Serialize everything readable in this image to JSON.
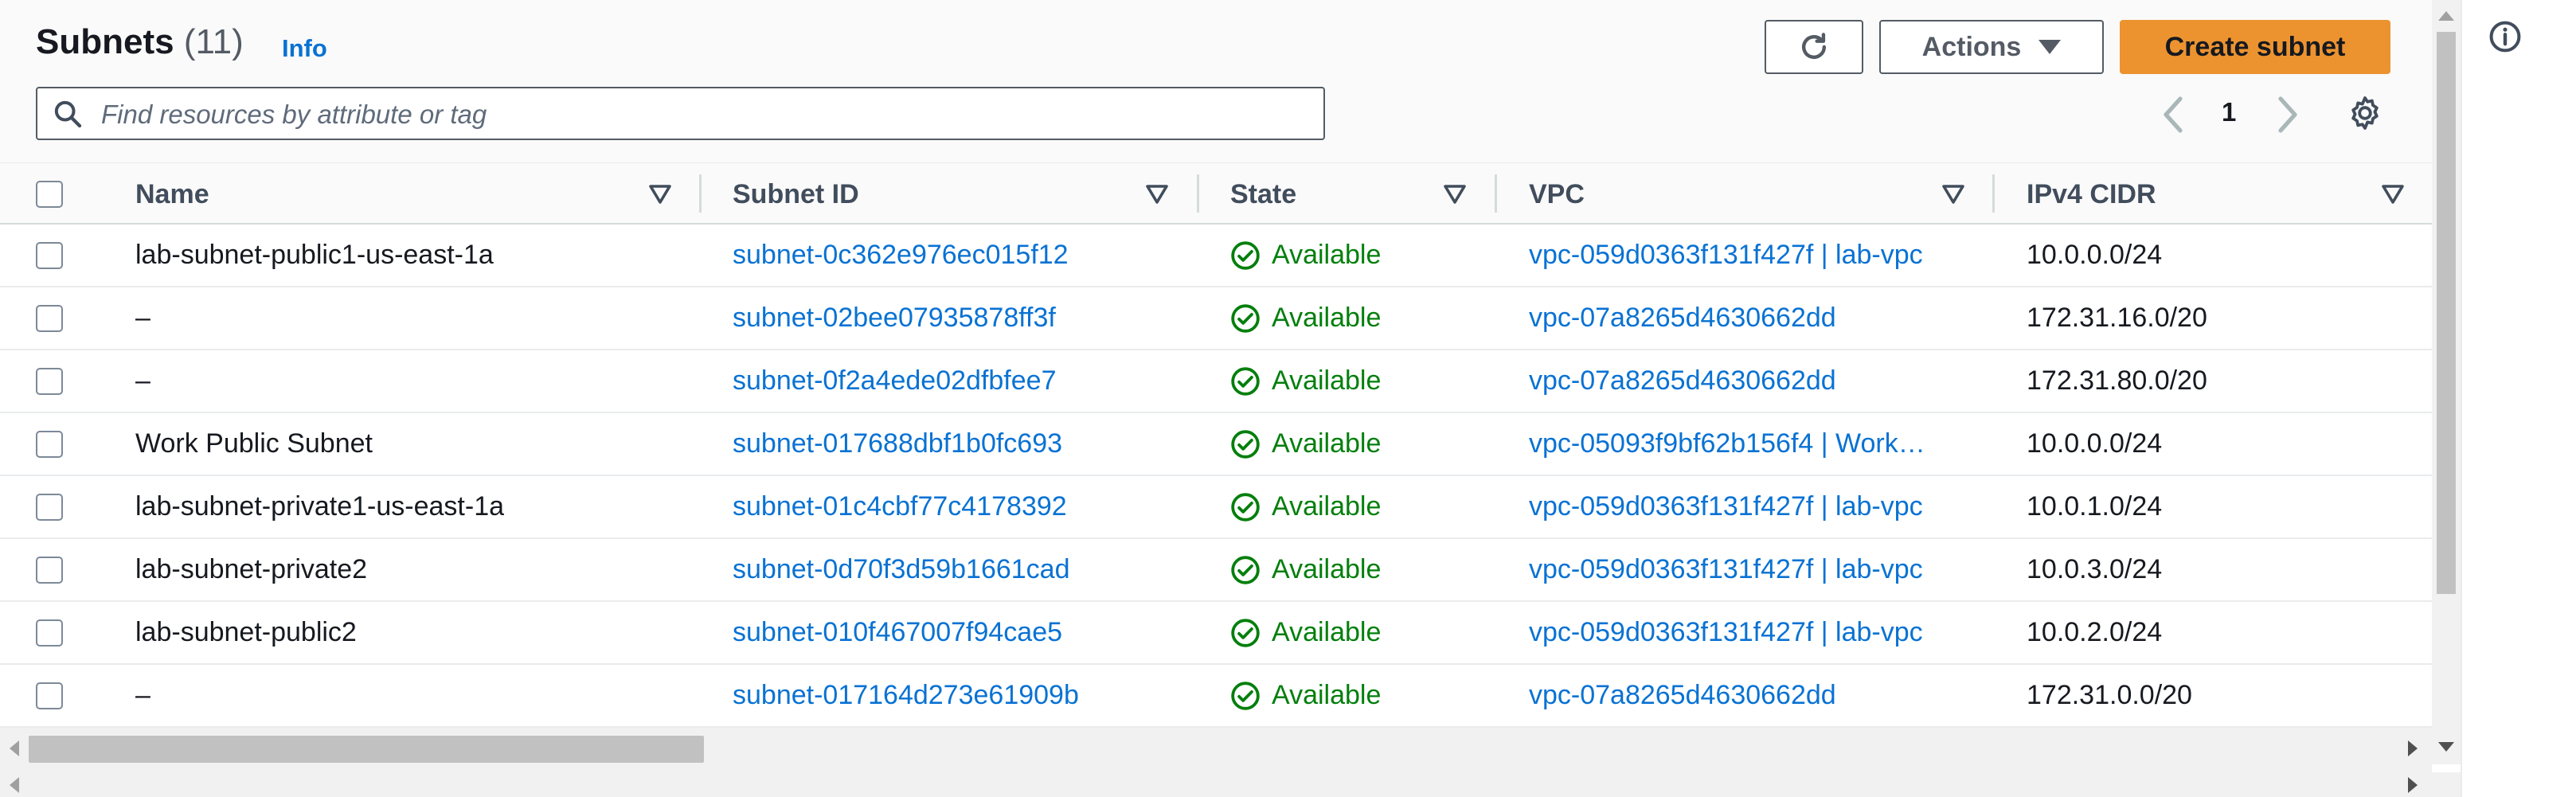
{
  "header": {
    "title": "Subnets",
    "count": "(11)",
    "info_label": "Info"
  },
  "toolbar": {
    "refresh_icon": "refresh-icon",
    "actions_label": "Actions",
    "create_label": "Create subnet"
  },
  "search": {
    "placeholder": "Find resources by attribute or tag"
  },
  "pagination": {
    "current_page": "1"
  },
  "columns": [
    "Name",
    "Subnet ID",
    "State",
    "VPC",
    "IPv4 CIDR"
  ],
  "rows": [
    {
      "name": "lab-subnet-public1-us-east-1a",
      "subnet_id": "subnet-0c362e976ec015f12",
      "state": "Available",
      "vpc": "vpc-059d0363f131f427f | lab-vpc",
      "cidr": "10.0.0.0/24"
    },
    {
      "name": "–",
      "subnet_id": "subnet-02bee07935878ff3f",
      "state": "Available",
      "vpc": "vpc-07a8265d4630662dd",
      "cidr": "172.31.16.0/20"
    },
    {
      "name": "–",
      "subnet_id": "subnet-0f2a4ede02dfbfee7",
      "state": "Available",
      "vpc": "vpc-07a8265d4630662dd",
      "cidr": "172.31.80.0/20"
    },
    {
      "name": "Work Public Subnet",
      "subnet_id": "subnet-017688dbf1b0fc693",
      "state": "Available",
      "vpc": "vpc-05093f9bf62b156f4 | Work…",
      "cidr": "10.0.0.0/24"
    },
    {
      "name": "lab-subnet-private1-us-east-1a",
      "subnet_id": "subnet-01c4cbf77c4178392",
      "state": "Available",
      "vpc": "vpc-059d0363f131f427f | lab-vpc",
      "cidr": "10.0.1.0/24"
    },
    {
      "name": "lab-subnet-private2",
      "subnet_id": "subnet-0d70f3d59b1661cad",
      "state": "Available",
      "vpc": "vpc-059d0363f131f427f | lab-vpc",
      "cidr": "10.0.3.0/24"
    },
    {
      "name": "lab-subnet-public2",
      "subnet_id": "subnet-010f467007f94cae5",
      "state": "Available",
      "vpc": "vpc-059d0363f131f427f | lab-vpc",
      "cidr": "10.0.2.0/24"
    },
    {
      "name": "–",
      "subnet_id": "subnet-017164d273e61909b",
      "state": "Available",
      "vpc": "vpc-07a8265d4630662dd",
      "cidr": "172.31.0.0/20"
    }
  ],
  "colors": {
    "primary_button": "#ec9330",
    "link": "#0972d3",
    "status_available": "#037f0c"
  }
}
